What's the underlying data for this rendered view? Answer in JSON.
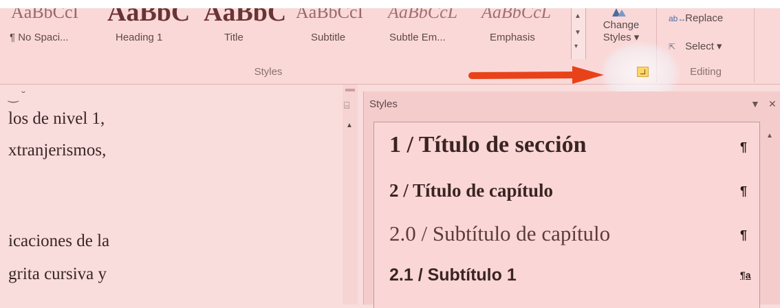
{
  "ribbon": {
    "gallery_previews": [
      "AaBbCcI",
      "AaBbC",
      "AaBbC",
      "AaBbCcI",
      "AaBbCcL",
      "AaBbCcL"
    ],
    "gallery_labels": [
      "¶ No Spaci...",
      "Heading 1",
      "Title",
      "Subtitle",
      "Subtle Em...",
      "Emphasis"
    ],
    "change_styles": {
      "line1": "Change",
      "line2": "Styles ▾"
    },
    "editing": {
      "replace": "Replace",
      "select": "Select ▾"
    },
    "group_styles": "Styles",
    "group_editing": "Editing"
  },
  "document": {
    "lines": [
      "los de nivel 1,",
      "xtranjerismos,",
      "icaciones de la",
      "grita cursiva y"
    ]
  },
  "styles_pane": {
    "title": "Styles",
    "items": [
      {
        "label": "1 / Título de sección",
        "mark": "¶"
      },
      {
        "label": "2 / Título de capítulo",
        "mark": "¶"
      },
      {
        "label": "2.0 / Subtítulo de capítulo",
        "mark": "¶"
      },
      {
        "label": "2.1 / Subtítulo 1",
        "mark": "¶a"
      }
    ]
  },
  "colors": {
    "ribbon_bg": "#fad8d8",
    "pane_bg": "#f5cccc",
    "arrow": "#e8421a",
    "launcher": "#ffd56a"
  },
  "icons": [
    "chevron-up-icon",
    "chevron-down-icon",
    "more-icon",
    "change-styles-icon",
    "replace-icon",
    "select-cursor-icon",
    "dialog-launcher-icon",
    "pane-options-icon",
    "close-icon",
    "paragraph-mark-icon",
    "linked-style-icon"
  ]
}
